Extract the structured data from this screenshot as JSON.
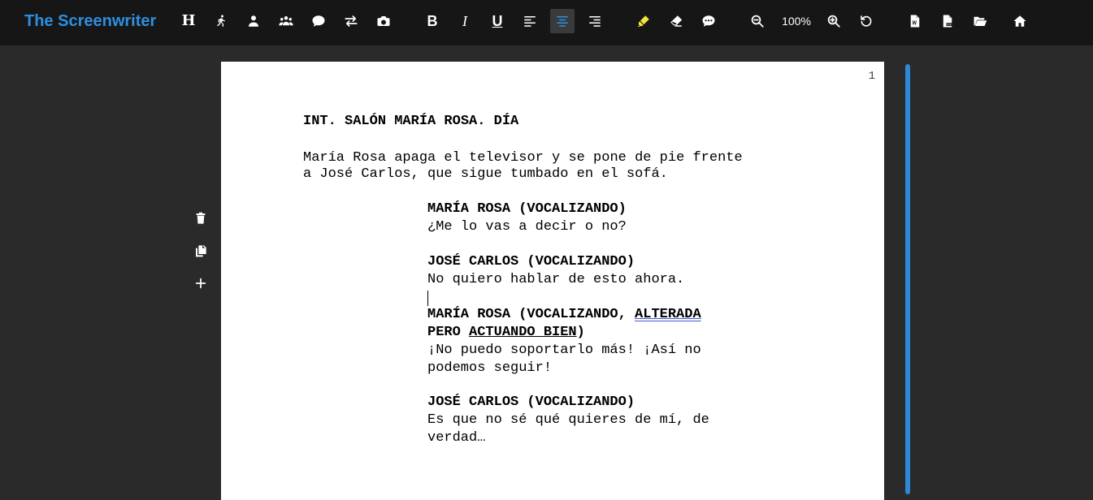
{
  "app": {
    "name": "The Screenwriter",
    "accent_color": "#2e8fe0"
  },
  "toolbar": {
    "heading_letter": "H",
    "bold_letter": "B",
    "italic_letter": "I",
    "underline_letter": "U",
    "zoom_level": "100%",
    "highlight_color": "#f5e43a"
  },
  "sidebar_tools": [
    {
      "icon": "trash-icon"
    },
    {
      "icon": "copy-icon"
    },
    {
      "icon": "plus-icon"
    }
  ],
  "page": {
    "number": "1",
    "scene_heading": "INT. SALÓN MARÍA ROSA. DÍA",
    "action": [
      "María Rosa apaga el televisor y se pone de pie frente",
      "a José Carlos, que sigue tumbado en el sofá."
    ],
    "dialogue_1": {
      "character": "MARÍA ROSA (VOCALIZANDO)",
      "lines": [
        "¿Me lo vas a decir o no?"
      ]
    },
    "dialogue_2": {
      "character": "JOSÉ CARLOS (VOCALIZANDO)",
      "lines": [
        "No quiero hablar de esto ahora."
      ]
    },
    "dialogue_3": {
      "character_a": "MARÍA ROSA (VOCALIZANDO, ",
      "character_b": "ALTERADA",
      "character_c": "PERO ",
      "character_d": "ACTUANDO BIEN",
      "character_e": ")",
      "lines": [
        "¡No puedo soportarlo más! ¡Así no",
        "podemos seguir!"
      ]
    },
    "dialogue_4": {
      "character": "JOSÉ CARLOS (VOCALIZANDO)",
      "lines": [
        "Es que no sé qué quieres de mí, de",
        "verdad…"
      ]
    }
  }
}
